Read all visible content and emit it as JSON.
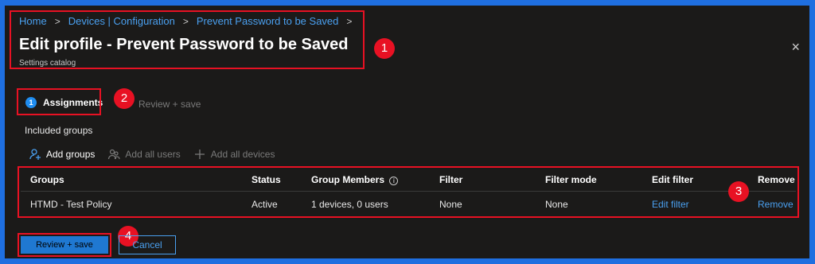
{
  "breadcrumb": {
    "items": [
      "Home",
      "Devices | Configuration",
      "Prevent Password to be Saved"
    ],
    "separator": ">"
  },
  "header": {
    "title": "Edit profile - Prevent Password to be Saved",
    "subtitle": "Settings catalog",
    "close_icon": "×"
  },
  "steps": {
    "current": {
      "number": "1",
      "label": "Assignments"
    },
    "next": {
      "label": "Review + save"
    }
  },
  "section": {
    "included_label": "Included groups"
  },
  "actions": [
    {
      "label": "Add groups",
      "icon": "add-person-icon",
      "enabled": true
    },
    {
      "label": "Add all users",
      "icon": "people-icon",
      "enabled": false
    },
    {
      "label": "Add all devices",
      "icon": "plus-icon",
      "enabled": false
    }
  ],
  "table": {
    "headers": {
      "groups": "Groups",
      "status": "Status",
      "members": "Group Members",
      "filter": "Filter",
      "filter_mode": "Filter mode",
      "edit_filter": "Edit filter",
      "remove": "Remove"
    },
    "row": {
      "group": "HTMD - Test Policy",
      "status": "Active",
      "members": "1 devices, 0 users",
      "filter": "None",
      "filter_mode": "None",
      "edit_filter": "Edit filter",
      "remove": "Remove"
    }
  },
  "footer": {
    "primary_label": "Review + save",
    "secondary_label": "Cancel"
  },
  "annotations": [
    "1",
    "2",
    "3",
    "4"
  ],
  "colors": {
    "accent": "#1f78d1",
    "highlight": "#e81123",
    "background": "#1b1a19",
    "link": "#4aa0f0"
  }
}
